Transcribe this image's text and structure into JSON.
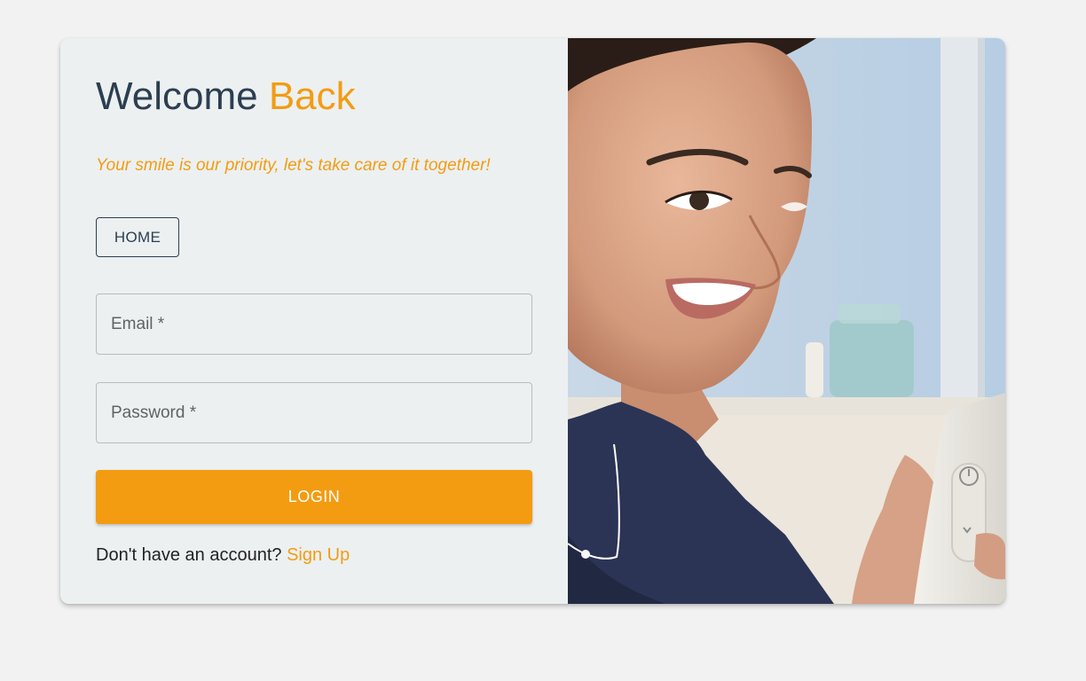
{
  "login": {
    "title_part1": "Welcome",
    "title_part2": "Back",
    "tagline": "Your smile is our priority, let's take care of it together!",
    "home_label": "HOME",
    "email_placeholder": "Email *",
    "password_placeholder": "Password *",
    "login_label": "LOGIN",
    "signup_prompt": "Don't have an account?",
    "signup_link": "Sign Up"
  },
  "colors": {
    "accent": "#f39c12",
    "heading": "#2c3e50",
    "panel": "#ecf0f1",
    "page_bg": "#f2f2f2"
  }
}
